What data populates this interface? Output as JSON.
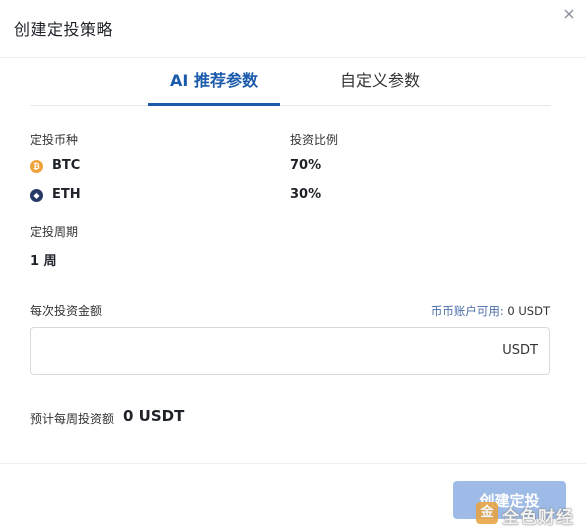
{
  "dialog": {
    "title": "创建定投策略"
  },
  "tabs": [
    {
      "label": "AI 推荐参数",
      "active": true
    },
    {
      "label": "自定义参数",
      "active": false
    }
  ],
  "coins": {
    "label": "定投币种",
    "ratio_label": "投资比例",
    "items": [
      {
        "symbol": "BTC",
        "ratio": "70%",
        "icon": "bitcoin-icon",
        "icon_glyph": "₿",
        "color": "#f0a23a"
      },
      {
        "symbol": "ETH",
        "ratio": "30%",
        "icon": "ethereum-icon",
        "icon_glyph": "◆",
        "color": "#263a68"
      }
    ]
  },
  "period": {
    "label": "定投周期",
    "value": "1 周"
  },
  "amount": {
    "label": "每次投资金额",
    "available_label": "币币账户可用:",
    "available_value": "0 USDT",
    "value": "",
    "unit": "USDT"
  },
  "estimate": {
    "label": "预计每周投资额",
    "value": "0 USDT"
  },
  "footer": {
    "create_label": "创建定投"
  },
  "watermark": {
    "text": "全色财经",
    "logo_glyph": "金"
  },
  "colors": {
    "accent": "#1b5bab",
    "button_disabled": "#9dbbe6",
    "btc": "#f0a23a",
    "eth": "#263a68"
  }
}
